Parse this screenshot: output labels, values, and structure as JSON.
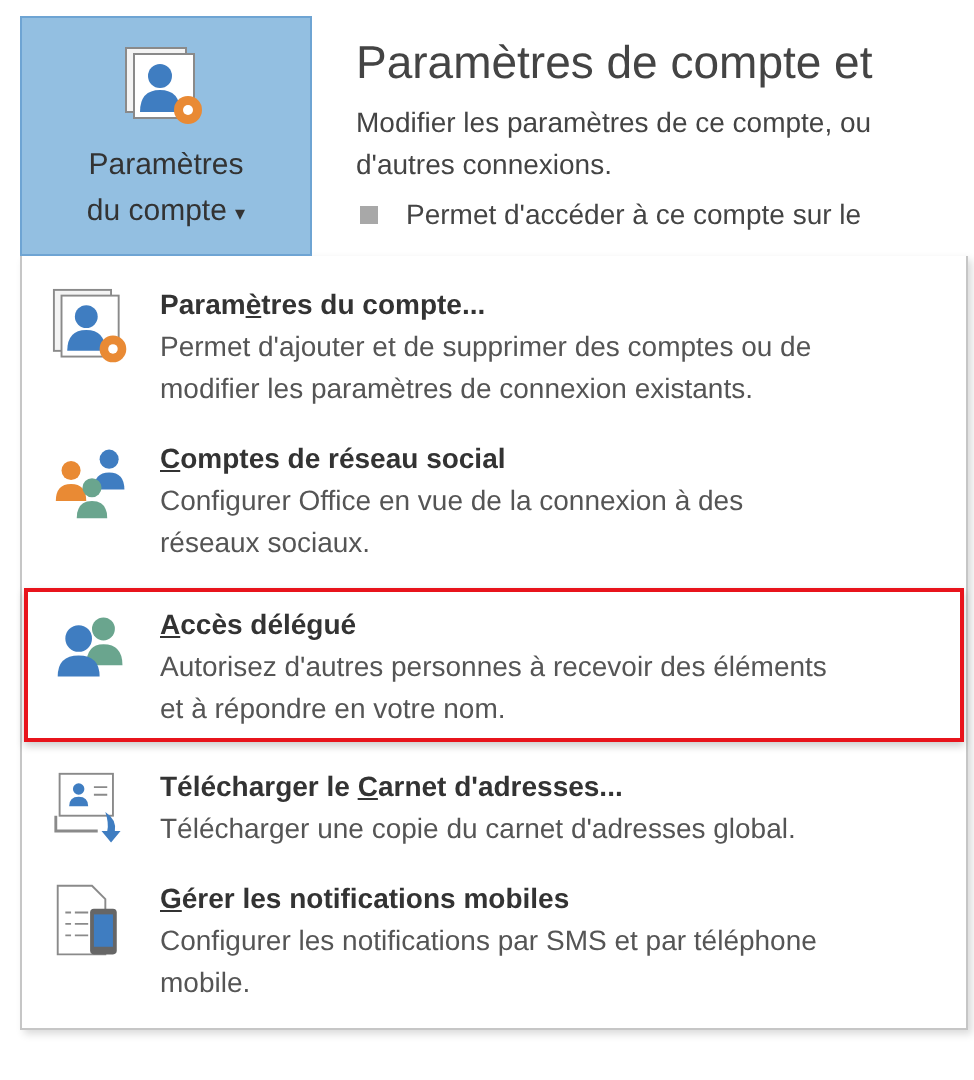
{
  "account_button": {
    "line_1": "Paramètres",
    "line_2": "du compte",
    "caret": "▾",
    "selected": true
  },
  "heading": "Paramètres de compte et",
  "description": "Modifier les paramètres de ce compte, ou d'autres connexions.",
  "bullet": "Permet d'accéder à ce compte sur le",
  "menu_items": [
    {
      "kind": "account-settings",
      "title_pre": "Param",
      "access_key": "è",
      "title_post": "tres du compte...",
      "description": "Permet d'ajouter et de supprimer des comptes ou de modifier les paramètres de connexion existants.",
      "selected": false
    },
    {
      "kind": "social",
      "access_key": "C",
      "title_post": "omptes de réseau social",
      "description": "Configurer Office en vue de la connexion à des réseaux sociaux.",
      "selected": false
    },
    {
      "kind": "delegate",
      "access_key": "A",
      "title_post": "ccès délégué",
      "description": "Autorisez d'autres personnes à recevoir des éléments et à répondre en votre nom.",
      "selected": true
    },
    {
      "kind": "address-book",
      "title_pre": "Télécharger le ",
      "access_key": "C",
      "title_post": "arnet d'adresses...",
      "description": "Télécharger une copie du carnet d'adresses global.",
      "selected": false
    },
    {
      "kind": "mobile",
      "access_key": "G",
      "title_post": "érer les notifications mobiles",
      "description": "Configurer les notifications par SMS et par téléphone mobile.",
      "selected": false
    }
  ]
}
